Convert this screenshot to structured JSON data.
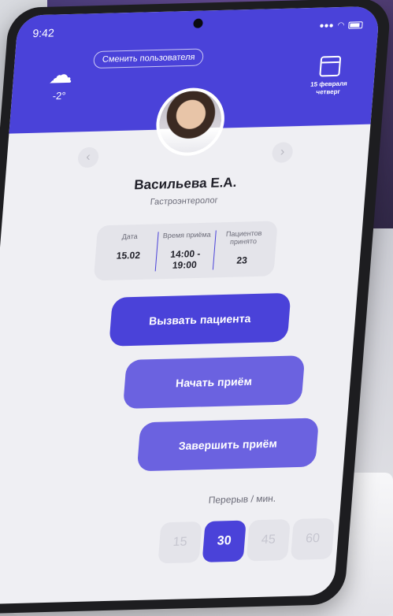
{
  "status": {
    "time": "9:42"
  },
  "header": {
    "switch_user_label": "Сменить пользователя",
    "weather": {
      "icon": "partly-cloudy-icon",
      "temperature": "-2°"
    },
    "date": {
      "icon": "calendar-icon",
      "day": "15 февраля",
      "weekday": "четверг"
    }
  },
  "doctor": {
    "name": "Васильева Е.А.",
    "specialty": "Гастроэнтеролог"
  },
  "info": [
    {
      "label": "Дата",
      "value": "15.02"
    },
    {
      "label": "Время приёма",
      "value": "14:00 - 19:00"
    },
    {
      "label": "Пациентов принято",
      "value": "23"
    }
  ],
  "actions": {
    "call_patient": "Вызвать пациента",
    "start_appointment": "Начать приём",
    "finish_appointment": "Завершить приём"
  },
  "break": {
    "label": "Перерыв / мин.",
    "options": [
      "15",
      "30",
      "45",
      "60"
    ],
    "selected": "30"
  },
  "colors": {
    "accent": "#4a42d9",
    "accent_light": "#6b62e0"
  }
}
